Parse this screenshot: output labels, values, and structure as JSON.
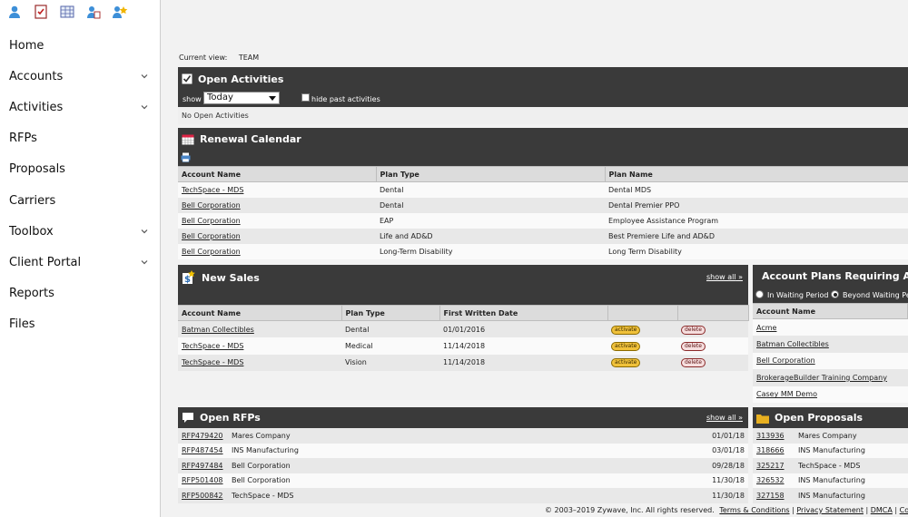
{
  "toolbar_icons": [
    "user-icon",
    "activity-checklist-icon",
    "report-grid-icon",
    "user-document-icon",
    "user-star-icon"
  ],
  "nav": [
    {
      "label": "Home",
      "expandable": false
    },
    {
      "label": "Accounts",
      "expandable": true
    },
    {
      "label": "Activities",
      "expandable": true
    },
    {
      "label": "RFPs",
      "expandable": false
    },
    {
      "label": "Proposals",
      "expandable": false
    },
    {
      "label": "Carriers",
      "expandable": false
    },
    {
      "label": "Toolbox",
      "expandable": true
    },
    {
      "label": "Client Portal",
      "expandable": true
    },
    {
      "label": "Reports",
      "expandable": false
    },
    {
      "label": "Files",
      "expandable": false
    }
  ],
  "view": {
    "label": "Current view:",
    "value": "TEAM"
  },
  "open_activities": {
    "title": "Open Activities",
    "show_label": "show",
    "show_value": "Today",
    "hide_past_label": "hide past activities",
    "empty_text": "No Open Activities"
  },
  "renewal": {
    "title": "Renewal Calendar",
    "columns": [
      "Account Name",
      "Plan Type",
      "Plan Name"
    ],
    "rows": [
      [
        "TechSpace - MDS",
        "Dental",
        "Dental MDS"
      ],
      [
        "Bell Corporation",
        "Dental",
        "Dental Premier PPO"
      ],
      [
        "Bell Corporation",
        "EAP",
        "Employee Assistance Program"
      ],
      [
        "Bell Corporation",
        "Life and AD&D",
        "Best Premiere Life and AD&D"
      ],
      [
        "Bell Corporation",
        "Long-Term Disability",
        "Long Term Disability"
      ]
    ]
  },
  "new_sales": {
    "title": "New Sales",
    "show_all": "show all",
    "columns": [
      "Account Name",
      "Plan Type",
      "First Written Date",
      "",
      ""
    ],
    "activate_label": "activate",
    "delete_label": "delete",
    "rows": [
      [
        "Batman Collectibles",
        "Dental",
        "01/01/2016"
      ],
      [
        "TechSpace - MDS",
        "Medical",
        "11/14/2018"
      ],
      [
        "TechSpace - MDS",
        "Vision",
        "11/14/2018"
      ]
    ]
  },
  "account_plans": {
    "title": "Account Plans Requiring A",
    "radio1": "In Waiting Period",
    "radio2": "Beyond Waiting Per",
    "column": "Account Name",
    "rows": [
      "Acme",
      "Batman Collectibles",
      "Bell Corporation",
      "BrokerageBuilder Training Company",
      "Casey MM Demo"
    ]
  },
  "open_rfps": {
    "title": "Open RFPs",
    "show_all": "show all",
    "rows": [
      [
        "RFP479420",
        "Mares Company",
        "01/01/18"
      ],
      [
        "RFP487454",
        "INS Manufacturing",
        "03/01/18"
      ],
      [
        "RFP497484",
        "Bell Corporation",
        "09/28/18"
      ],
      [
        "RFP501408",
        "Bell Corporation",
        "11/30/18"
      ],
      [
        "RFP500842",
        "TechSpace - MDS",
        "11/30/18"
      ]
    ]
  },
  "open_proposals": {
    "title": "Open Proposals",
    "rows": [
      [
        "313936",
        "Mares Company"
      ],
      [
        "318666",
        "INS Manufacturing"
      ],
      [
        "325217",
        "TechSpace - MDS"
      ],
      [
        "326532",
        "INS Manufacturing"
      ],
      [
        "327158",
        "INS Manufacturing"
      ]
    ]
  },
  "footer": {
    "copyright": "© 2003–2019 Zywave, Inc. All rights reserved.",
    "terms": "Terms & Conditions",
    "privacy": "Privacy Statement",
    "dmca": "DMCA",
    "contact": "Contact"
  }
}
